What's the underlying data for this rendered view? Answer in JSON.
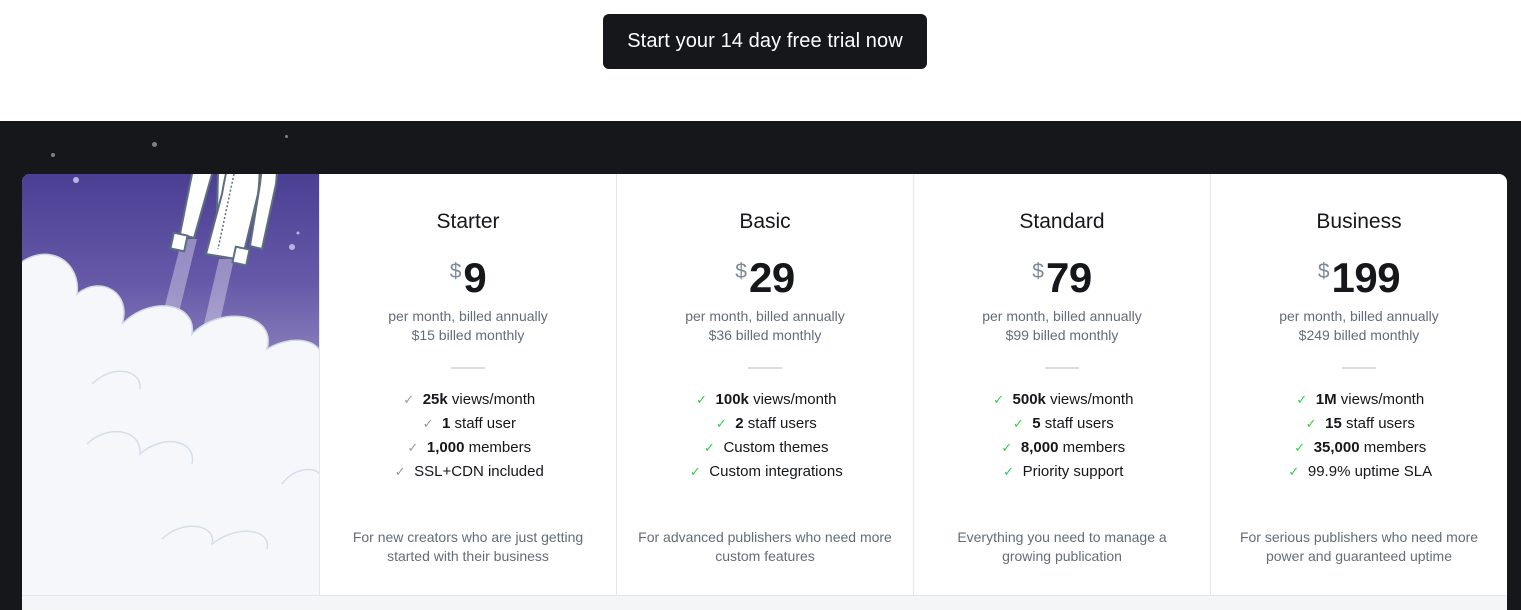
{
  "cta": {
    "label": "Start your 14 day free trial now"
  },
  "plans": [
    {
      "name": "Starter",
      "currency": "$",
      "amount": "9",
      "billing_annual": "per month, billed annually",
      "billing_monthly": "$15 billed monthly",
      "features": [
        {
          "bold": "25k",
          "text": " views/month"
        },
        {
          "bold": "1",
          "text": " staff user"
        },
        {
          "bold": "1,000",
          "text": " members"
        },
        {
          "bold": "",
          "text": "SSL+CDN included"
        }
      ],
      "description": "For new creators who are just getting started with their business"
    },
    {
      "name": "Basic",
      "currency": "$",
      "amount": "29",
      "billing_annual": "per month, billed annually",
      "billing_monthly": "$36 billed monthly",
      "features": [
        {
          "bold": "100k",
          "text": " views/month"
        },
        {
          "bold": "2",
          "text": " staff users"
        },
        {
          "bold": "",
          "text": "Custom themes"
        },
        {
          "bold": "",
          "text": "Custom integrations"
        }
      ],
      "description": "For advanced publishers who need more custom features"
    },
    {
      "name": "Standard",
      "currency": "$",
      "amount": "79",
      "billing_annual": "per month, billed annually",
      "billing_monthly": "$99 billed monthly",
      "features": [
        {
          "bold": "500k",
          "text": " views/month"
        },
        {
          "bold": "5",
          "text": " staff users"
        },
        {
          "bold": "8,000",
          "text": " members"
        },
        {
          "bold": "",
          "text": "Priority support"
        }
      ],
      "description": "Everything you need to manage a growing publication"
    },
    {
      "name": "Business",
      "currency": "$",
      "amount": "199",
      "billing_annual": "per month, billed annually",
      "billing_monthly": "$249 billed monthly",
      "features": [
        {
          "bold": "1M",
          "text": " views/month"
        },
        {
          "bold": "15",
          "text": " staff users"
        },
        {
          "bold": "35,000",
          "text": " members"
        },
        {
          "bold": "",
          "text": "99.9% uptime SLA"
        }
      ],
      "description": "For serious publishers who need more power and guaranteed uptime"
    }
  ],
  "icons": {
    "feature_check": "check-icon",
    "hero": "rocket-illustration"
  },
  "colors": {
    "dark_bg": "#15171a",
    "check_green": "#30cf43",
    "check_gray": "#8e9aa5",
    "hero_purple": "#4b3f94"
  }
}
